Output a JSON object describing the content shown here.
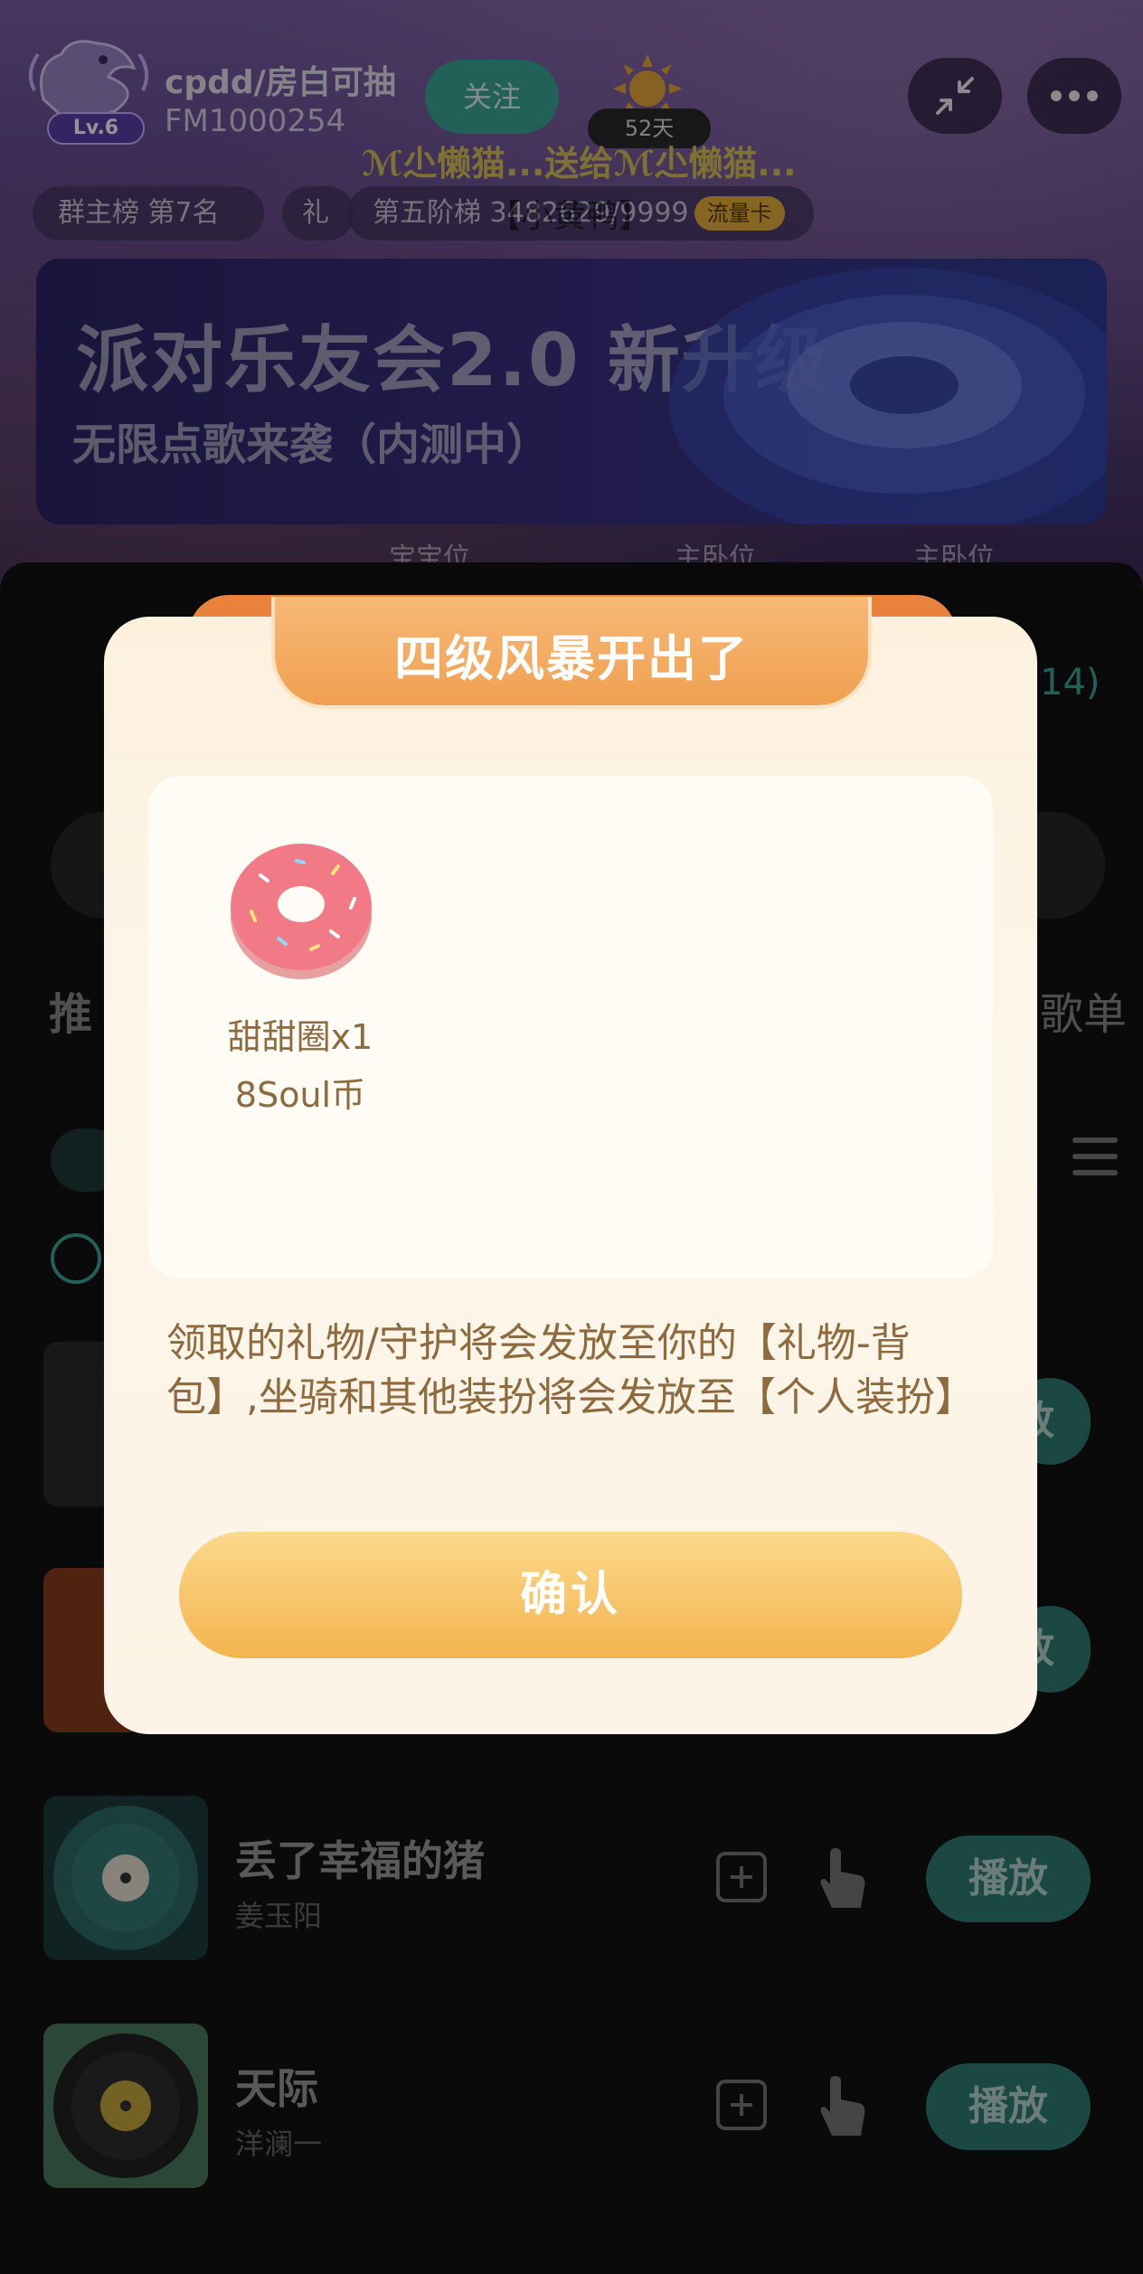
{
  "room": {
    "name": "cpdd/房白可抽",
    "id": "FM1000254",
    "level": "Lv.6",
    "follow_label": "关注",
    "days": "52天",
    "marquee": "ℳ尐懒猫...送给ℳ尐懒猫...",
    "overlay_name": "【小黄鸭】",
    "tags": {
      "rank": "群主榜 第7名",
      "gift": "礼",
      "tier": "第五阶梯 3482629/9999",
      "flow_card": "流量卡"
    },
    "banner": {
      "title": "派对乐友会2.0 新升级",
      "subtitle": "无限点歌来袭（内测中）"
    },
    "seats": [
      "宝宝位",
      "主卧位",
      "主卧位"
    ]
  },
  "sheet": {
    "count": "14)",
    "heading": "推",
    "right_label": "歌单",
    "songs": [
      {
        "title": "丢了幸福的猪",
        "artist": "姜玉阳",
        "play_label": "播放"
      },
      {
        "title": "天际",
        "artist": "洋澜一",
        "play_label": "播放"
      }
    ],
    "ghost_play_label": "放"
  },
  "modal": {
    "title": "四级风暴开出了",
    "reward": {
      "name": "甜甜圈x1",
      "price": "8Soul币"
    },
    "notice": "领取的礼物/守护将会发放至你的【礼物-背包】,坐骑和其他装扮将会发放至【个人装扮】",
    "confirm_label": "确认"
  },
  "colors": {
    "accent_teal": "#3aa797",
    "modal_bg": "#fdf3e6",
    "modal_text": "#8e6a3f",
    "confirm_gradient_top": "#fcd98c",
    "confirm_gradient_bottom": "#f3b44f",
    "ribbon": "#f0a050"
  }
}
